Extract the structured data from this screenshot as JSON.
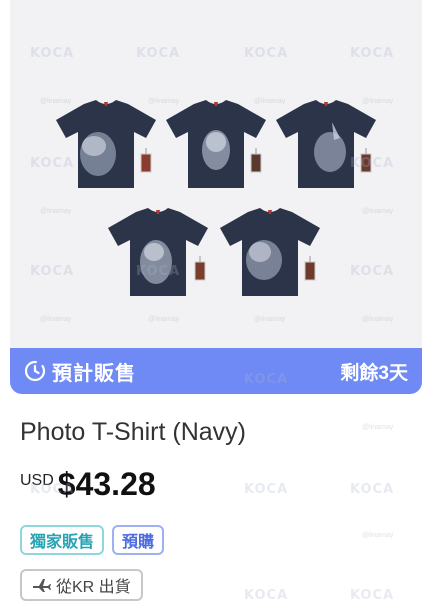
{
  "product_image": {
    "background": "#f2f2f4",
    "shirt_color": "#2b3449",
    "shirt_count": 5
  },
  "presale": {
    "label": "預計販售",
    "remaining": "剩餘3天",
    "icon": "clock-icon",
    "bar_color": "#6f8af5"
  },
  "product": {
    "title": "Photo T-Shirt (Navy)",
    "currency": "USD",
    "price": "$43.28"
  },
  "badges": [
    {
      "label": "獨家販售",
      "color": "#28a3b4"
    },
    {
      "label": "預購",
      "color": "#4d6ce0"
    }
  ],
  "shipping": {
    "label": "從KR 出貨",
    "icon": "airplane-icon"
  },
  "watermark": {
    "brand": "KOCA",
    "handle": "@linamay"
  }
}
